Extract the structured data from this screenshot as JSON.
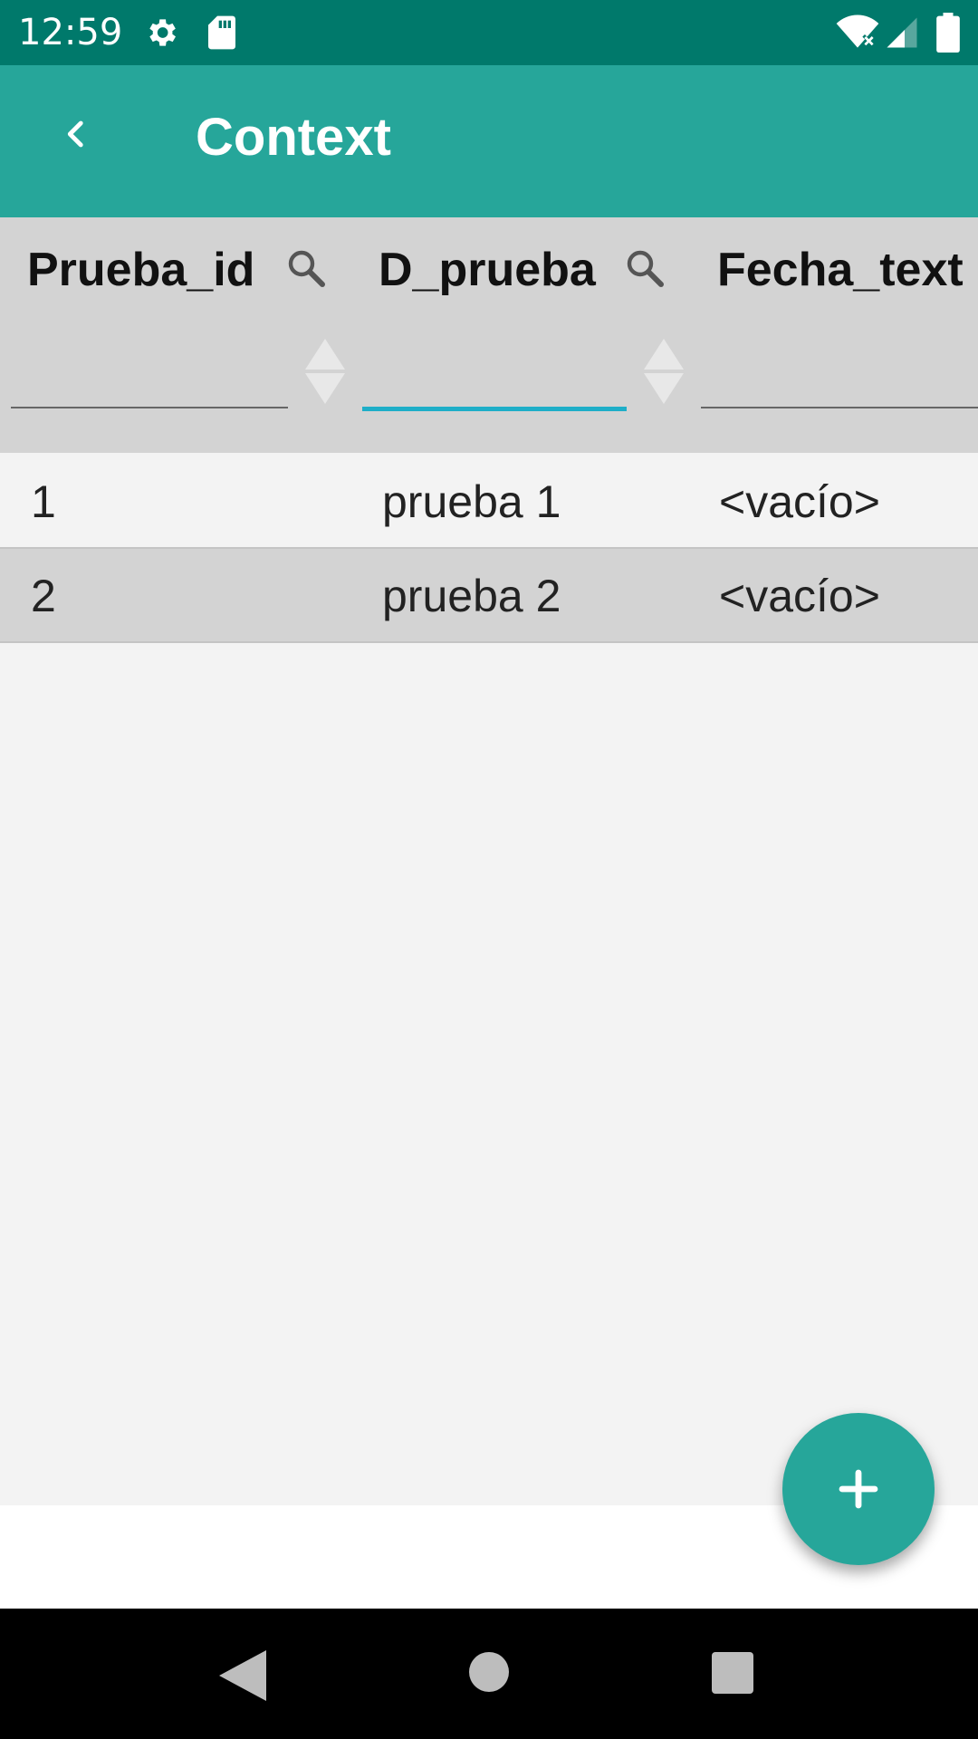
{
  "status_bar": {
    "time": "12:59",
    "icons": [
      "gear-icon",
      "sd-card-icon",
      "wifi-off-icon",
      "cell-signal-icon",
      "battery-icon"
    ]
  },
  "app_bar": {
    "title": "Context",
    "back_icon": "chevron-left-icon",
    "background": "#26a69a"
  },
  "table": {
    "columns": [
      {
        "title": "Prueba_id",
        "filter_value": ""
      },
      {
        "title": "D_prueba",
        "filter_value": ""
      },
      {
        "title": "Fecha_text",
        "filter_value": ""
      }
    ],
    "rows": [
      [
        "1",
        "prueba 1",
        "<vacío>"
      ],
      [
        "2",
        "prueba 2",
        "<vacío>"
      ]
    ]
  },
  "fab": {
    "icon": "plus-icon"
  },
  "nav_bar": {
    "icons": [
      "back-triangle-icon",
      "home-circle-icon",
      "recents-square-icon"
    ]
  },
  "colors": {
    "status_bar": "#00796b",
    "primary": "#26a69a",
    "focused_underline": "#1eaec8",
    "header_bg": "#d3d3d3",
    "content_bg": "#f3f3f3"
  }
}
